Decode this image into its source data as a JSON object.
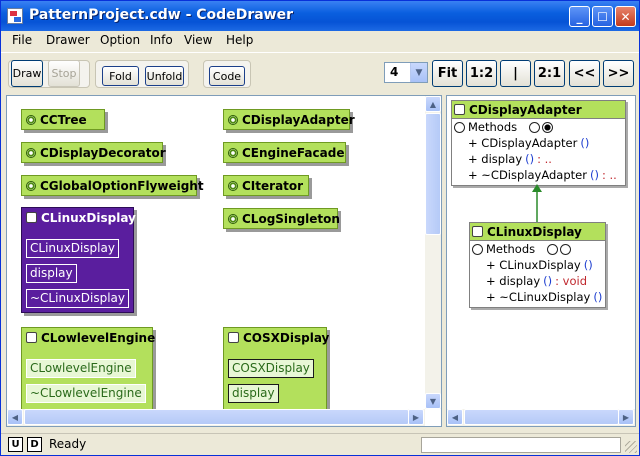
{
  "window": {
    "title": "PatternProject.cdw - CodeDrawer"
  },
  "menu": {
    "items": [
      "File",
      "Drawer",
      "Option",
      "Info",
      "View",
      "Help"
    ]
  },
  "toolbar": {
    "draw": "Draw",
    "stop": "Stop",
    "fold": "Fold",
    "unfold": "Unfold",
    "code": "Code",
    "zoom_value": "4",
    "fit": "Fit",
    "ratio_12": "1:2",
    "ratio_11": "|",
    "ratio_21": "2:1",
    "prev": "<<",
    "next": ">>"
  },
  "left": {
    "collapsed": [
      "CCTree",
      "CDisplayAdapter",
      "CDisplayDecorator",
      "CEngineFacade",
      "CGlobalOptionFlyweight",
      "CIterator",
      "CLogSingleton"
    ],
    "linux": {
      "title": "CLinuxDisplay",
      "members": [
        "CLinuxDisplay",
        "display",
        "~CLinuxDisplay"
      ]
    },
    "lowlevel": {
      "title": "CLowlevelEngine",
      "members": [
        "CLowlevelEngine",
        "~CLowlevelEngine"
      ]
    },
    "osx": {
      "title": "COSXDisplay",
      "members": [
        "COSXDisplay",
        "display"
      ]
    }
  },
  "right": {
    "adapter": {
      "title": "CDisplayAdapter",
      "methods_label": "Methods",
      "rows": [
        {
          "prefix": "+ CDisplayAdapter",
          "params": "()",
          "ret": ""
        },
        {
          "prefix": "+ display",
          "params": "()",
          "ret": ": .."
        },
        {
          "prefix": "+ ~CDisplayAdapter",
          "params": "()",
          "ret": ": .."
        }
      ]
    },
    "linux": {
      "title": "CLinuxDisplay",
      "methods_label": "Methods",
      "rows": [
        {
          "prefix": "+ CLinuxDisplay",
          "params": "()",
          "ret": ""
        },
        {
          "prefix": "+ display",
          "params": "()",
          "ret": ": void"
        },
        {
          "prefix": "+ ~CLinuxDisplay",
          "params": "()",
          "ret": ""
        }
      ]
    }
  },
  "status": {
    "u": "U",
    "d": "D",
    "text": "Ready"
  },
  "colors": {
    "node_green": "#b3e05c",
    "node_purple": "#5a1e9e",
    "title_blue": "#0653d6"
  }
}
